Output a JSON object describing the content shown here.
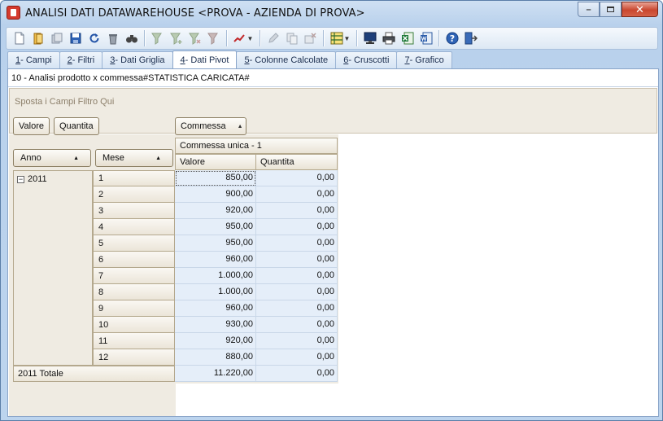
{
  "window": {
    "title": "ANALISI DATI DATAWAREHOUSE <PROVA - AZIENDA DI PROVA>"
  },
  "toolbar": {
    "buttons": [
      "new-doc-icon",
      "open-icon",
      "save-as-icon",
      "save-icon",
      "refresh-icon",
      "delete-icon",
      "find-icon",
      "filter-icon",
      "filter-add-icon",
      "filter-remove-icon",
      "filter-clear-icon",
      "chart-icon",
      "edit-icon",
      "copy-icon",
      "cancel-icon",
      "layout-icon",
      "monitor-icon",
      "print-icon",
      "excel-icon",
      "word-icon",
      "help-icon",
      "exit-icon"
    ]
  },
  "tabs": [
    {
      "key": "1",
      "label": " - Campi"
    },
    {
      "key": "2",
      "label": " - Filtri"
    },
    {
      "key": "3",
      "label": " - Dati Griglia"
    },
    {
      "key": "4",
      "label": " - Dati Pivot"
    },
    {
      "key": "5",
      "label": " - Colonne Calcolate"
    },
    {
      "key": "6",
      "label": " - Cruscotti"
    },
    {
      "key": "7",
      "label": " - Grafico"
    }
  ],
  "subtitle": "10 - Analisi prodotto x commessa#STATISTICA CARICATA#",
  "filter_hint": "Sposta i Campi Filtro Qui",
  "data_fields": {
    "valore": "Valore",
    "quantita": "Quantita"
  },
  "column_field": "Commessa",
  "row_fields": {
    "anno": "Anno",
    "mese": "Mese"
  },
  "column_group": "Commessa unica - 1",
  "column_headers": {
    "valore": "Valore",
    "quantita": "Quantita"
  },
  "year": "2011",
  "rows": [
    {
      "mese": "1",
      "valore": "850,00",
      "quantita": "0,00"
    },
    {
      "mese": "2",
      "valore": "900,00",
      "quantita": "0,00"
    },
    {
      "mese": "3",
      "valore": "920,00",
      "quantita": "0,00"
    },
    {
      "mese": "4",
      "valore": "950,00",
      "quantita": "0,00"
    },
    {
      "mese": "5",
      "valore": "950,00",
      "quantita": "0,00"
    },
    {
      "mese": "6",
      "valore": "960,00",
      "quantita": "0,00"
    },
    {
      "mese": "7",
      "valore": "1.000,00",
      "quantita": "0,00"
    },
    {
      "mese": "8",
      "valore": "1.000,00",
      "quantita": "0,00"
    },
    {
      "mese": "9",
      "valore": "960,00",
      "quantita": "0,00"
    },
    {
      "mese": "10",
      "valore": "930,00",
      "quantita": "0,00"
    },
    {
      "mese": "11",
      "valore": "920,00",
      "quantita": "0,00"
    },
    {
      "mese": "12",
      "valore": "880,00",
      "quantita": "0,00"
    }
  ],
  "total": {
    "label": "2011 Totale",
    "valore": "11.220,00",
    "quantita": "0,00"
  }
}
